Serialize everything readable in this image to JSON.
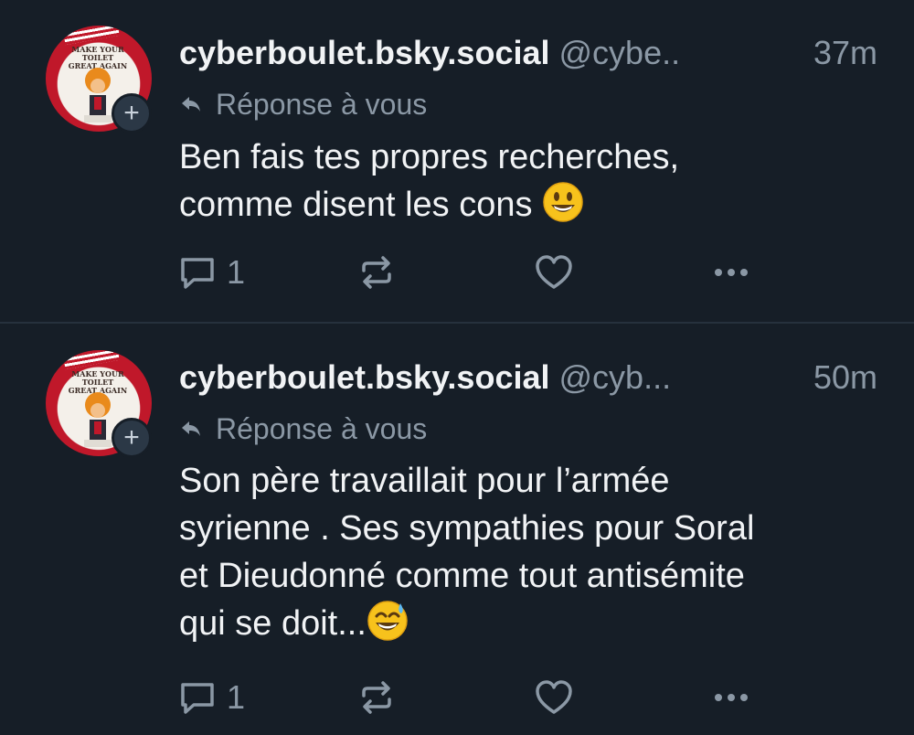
{
  "posts": [
    {
      "display_name": "cyberboulet.bsky.social",
      "handle": "@cybe..",
      "time": "37m",
      "reply_context": "Réponse à vous",
      "text_lines": [
        "Ben fais tes propres recherches,",
        "comme disent les cons"
      ],
      "emoji": "grinning-face",
      "reply_count": "1",
      "avatar_sign": [
        "MAKE YOUR TOILET",
        "GREAT AGAIN"
      ]
    },
    {
      "display_name": "cyberboulet.bsky.social",
      "handle": "@cyb...",
      "time": "50m",
      "reply_context": "Réponse à vous",
      "text_lines": [
        "Son père travaillait pour l’armée",
        "syrienne . Ses sympathies pour Soral",
        "et Dieudonné comme tout antisémite",
        "qui se doit..."
      ],
      "emoji": "grinning-face-with-sweat",
      "reply_count": "1",
      "avatar_sign": [
        "MAKE YOUR TOILET",
        "GREAT AGAIN"
      ]
    }
  ],
  "follow_label": "+",
  "colors": {
    "background": "#161e27",
    "text": "#f1f3f5",
    "muted": "#8b98a5",
    "divider": "#26313d"
  },
  "icons": [
    "reply-arrow-icon",
    "comment-icon",
    "repost-icon",
    "heart-icon",
    "more-options-icon",
    "plus-icon"
  ]
}
